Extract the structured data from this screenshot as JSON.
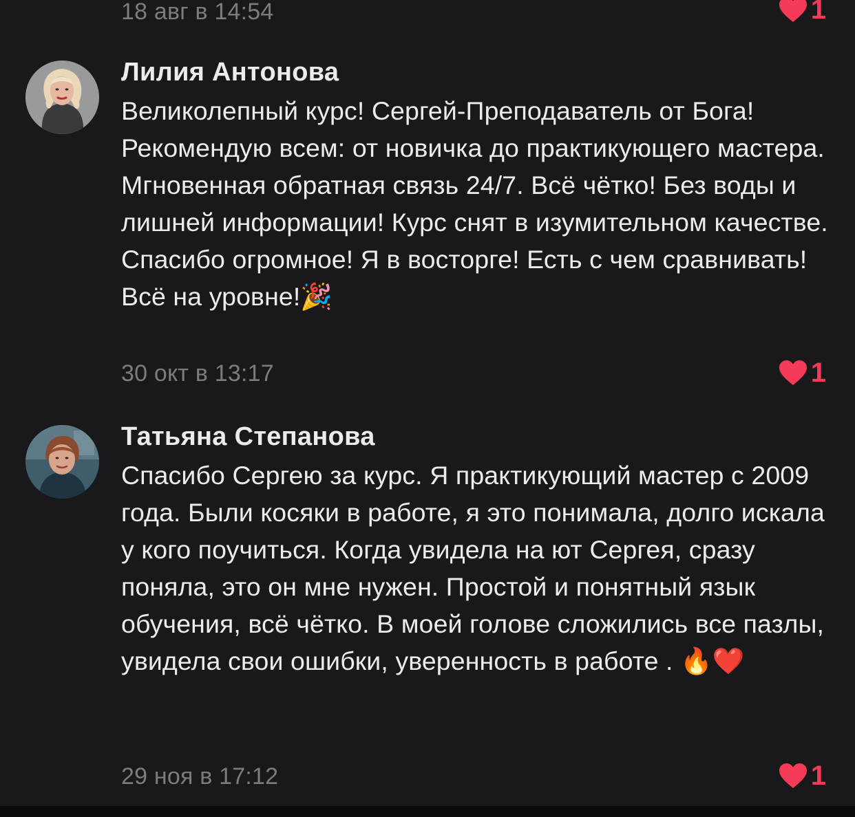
{
  "prev_comment": {
    "time": "18 авг в 14:54",
    "likes": "1"
  },
  "comments": [
    {
      "author": "Лилия Антонова",
      "text": "Великолепный курс!  Сергей-Преподаватель от Бога! Рекомендую всем: от новичка до практикующего мастера. Мгновенная обратная связь 24/7. Всё чётко! Без воды и лишней информации! Курс снят в изумительном качестве. Спасибо огромное! Я в восторге! Есть с чем сравнивать! Всё на уровне!🎉",
      "time": "30 окт в 13:17",
      "likes": "1"
    },
    {
      "author": "Татьяна Степанова",
      "text": "Спасибо Сергею за курс. Я практикующий мастер с 2009 года. Были косяки в работе, я это понимала, долго искала у кого поучиться. Когда увидела на ют Сергея, сразу поняла, это он мне нужен. Простой и понятный язык обучения, всё чётко. В моей голове сложились все пазлы, увидела свои ошибки, уверенность в работе . 🔥❤️",
      "time": "29 ноя в 17:12",
      "likes": "1"
    }
  ],
  "colors": {
    "background": "#19191b",
    "text": "#ececec",
    "muted": "#7b7b80",
    "like": "#f53b57"
  },
  "icons": {
    "like": "heart-icon"
  }
}
